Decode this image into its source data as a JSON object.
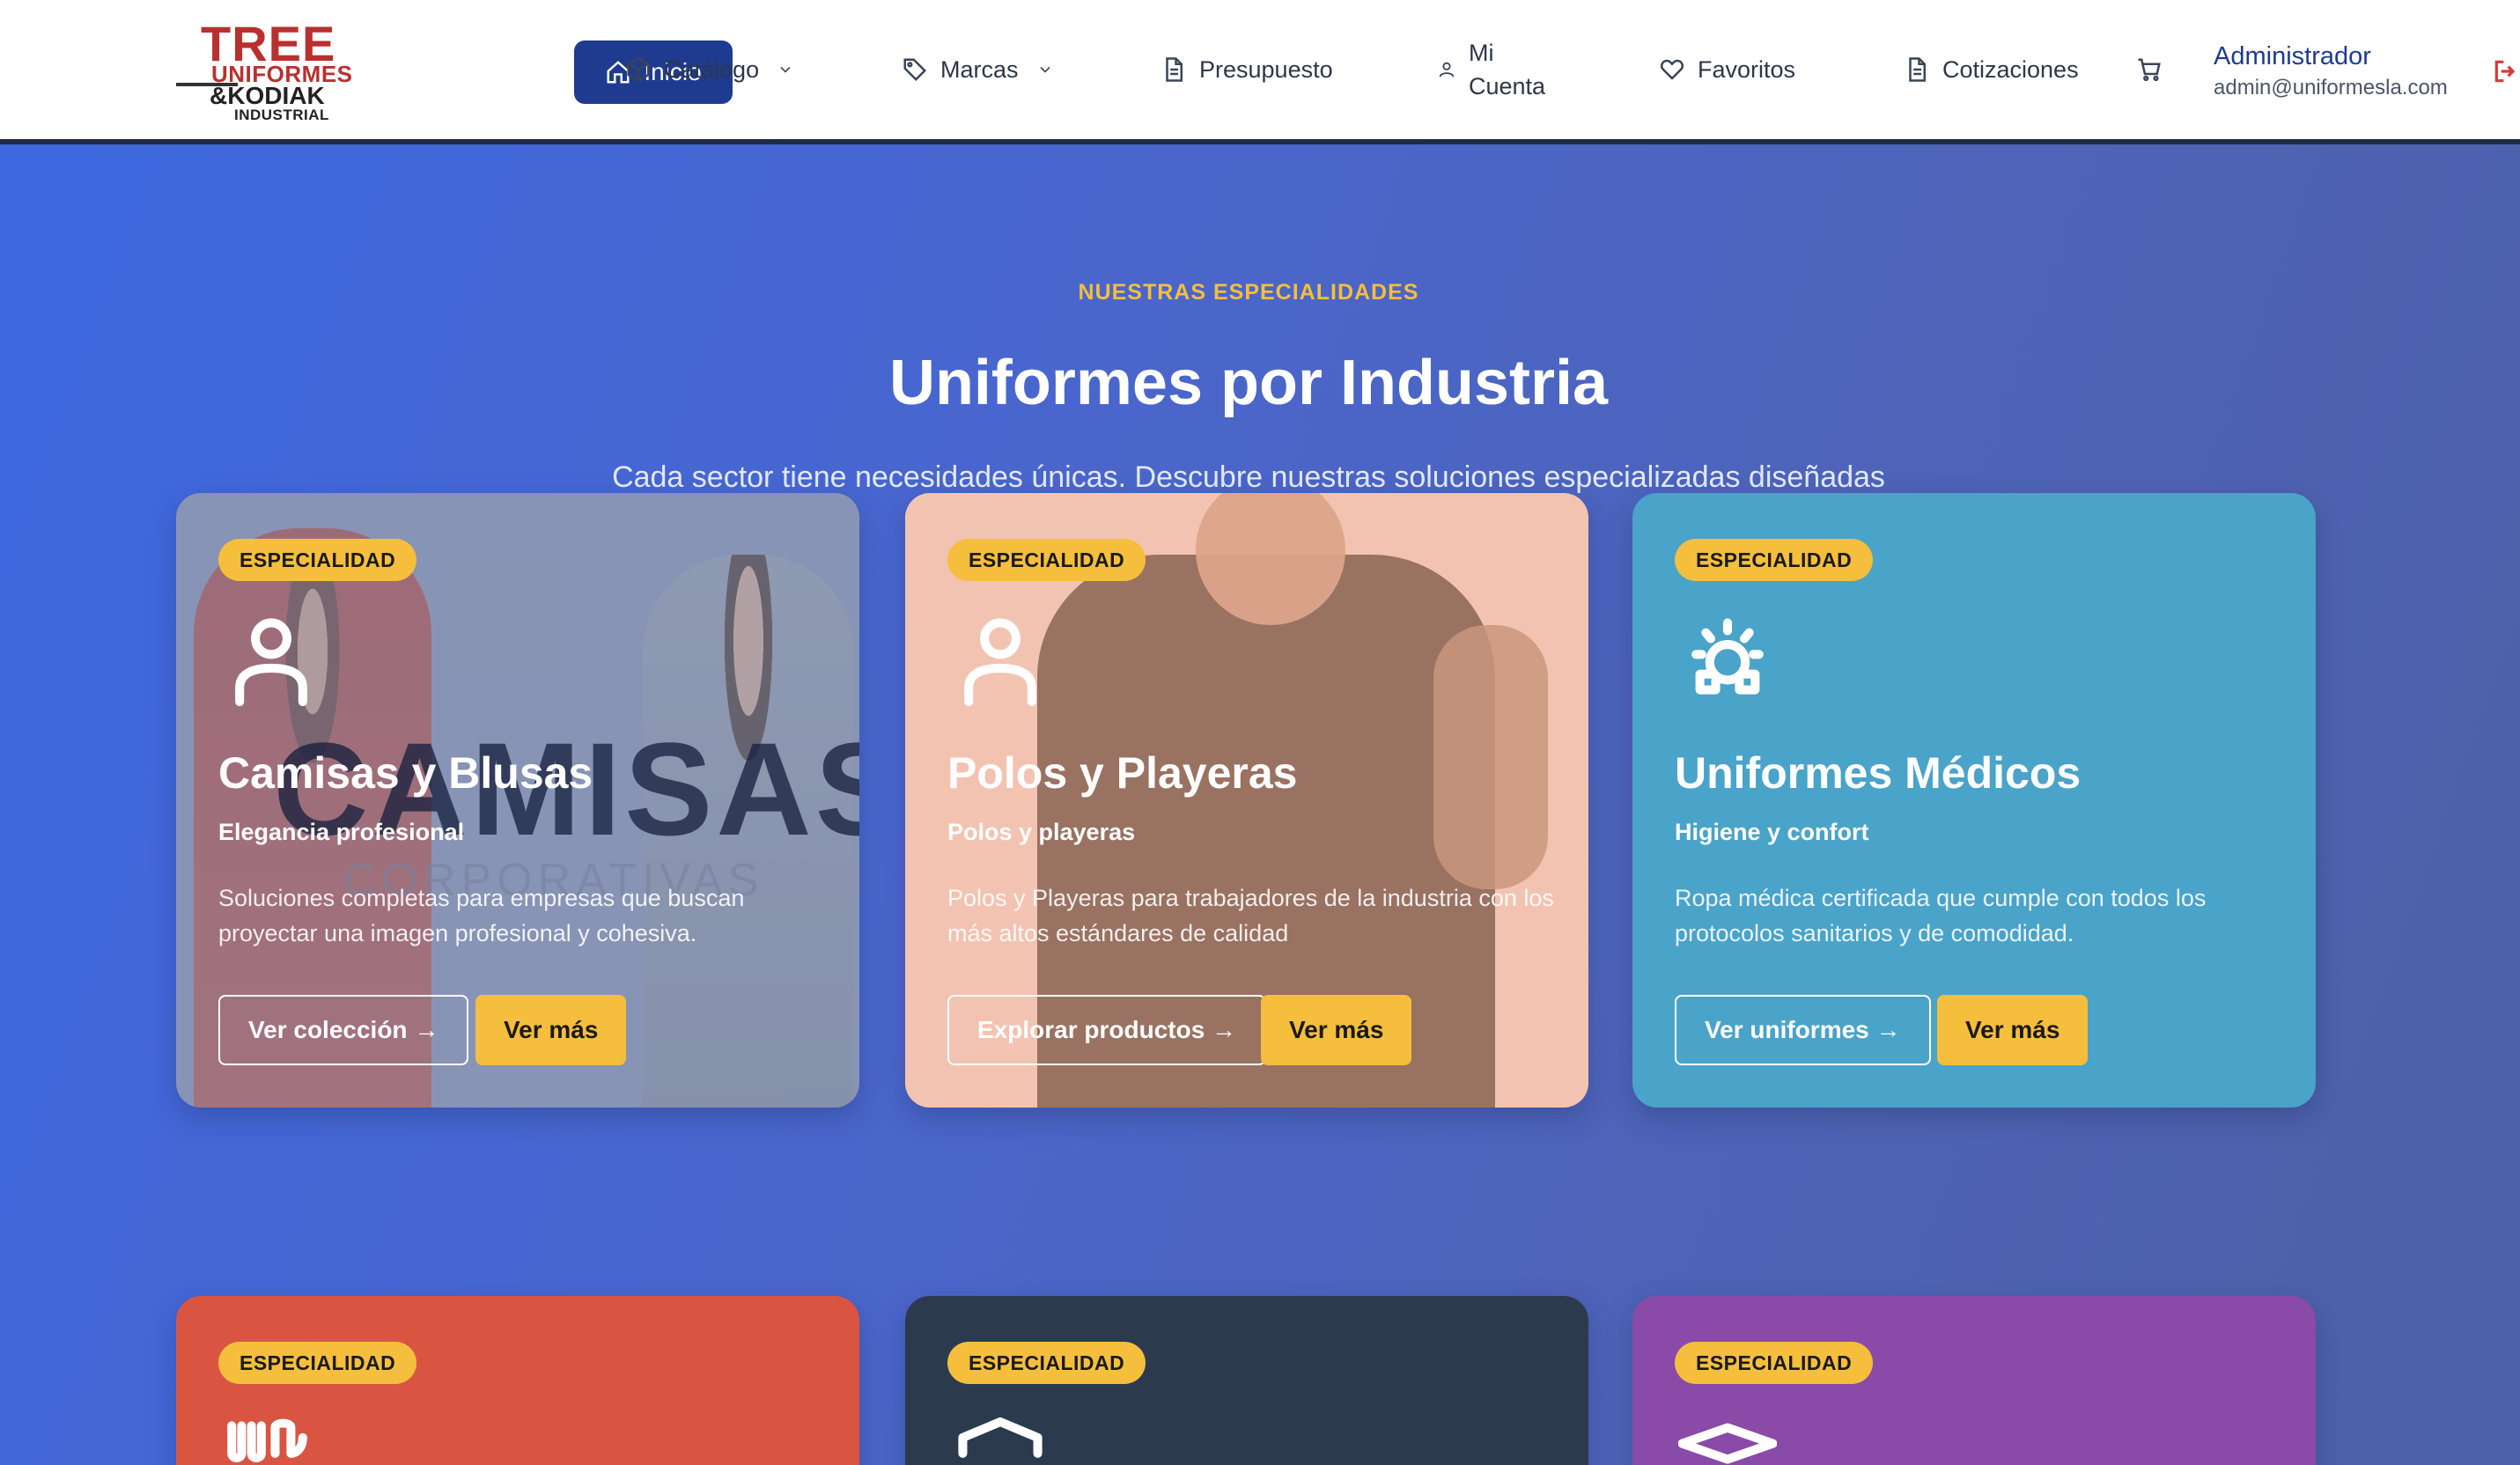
{
  "brand": {
    "logo_line1": "TREE",
    "logo_line2": "UNIFORMES",
    "logo_line3": "&KODIAK",
    "logo_line4": "INDUSTRIAL"
  },
  "nav": {
    "home": "Inicio",
    "catalog": "Catálogo",
    "brands": "Marcas",
    "budget": "Presupuesto",
    "account_line1": "Mi",
    "account_line2": "Cuenta",
    "favorites": "Favoritos",
    "quotes": "Cotizaciones"
  },
  "user": {
    "name": "Administrador",
    "email": "admin@uniformesla.com"
  },
  "hero": {
    "eyebrow": "NUESTRAS ESPECIALIDADES",
    "title": "Uniformes por Industria",
    "subtitle": "Cada sector tiene necesidades únicas. Descubre nuestras soluciones especializadas diseñadas específicamente para tu industria."
  },
  "cards": [
    {
      "badge": "ESPECIALIDAD",
      "icon": "user-icon",
      "title": "Camisas y Blusas",
      "tagline": "Elegancia profesional",
      "description": "Soluciones completas para empresas que buscan proyectar una imagen profesional y cohesiva.",
      "primary": "Ver colección →",
      "secondary": "Ver más",
      "watermark1": "CAMISAS",
      "watermark2": "CORPORATIVAS",
      "color": "#8d98b8"
    },
    {
      "badge": "ESPECIALIDAD",
      "icon": "user-icon",
      "title": "Polos y Playeras",
      "tagline": "Polos y playeras",
      "description": "Polos y Playeras para trabajadores de la industria con los más altos estándares de calidad",
      "primary": "Explorar productos →",
      "secondary": "Ver más",
      "color": "#f5c4b4"
    },
    {
      "badge": "ESPECIALIDAD",
      "icon": "medical-icon",
      "title": "Uniformes Médicos",
      "tagline": "Higiene y confort",
      "description": "Ropa médica certificada que cumple con todos los protocolos sanitarios y de comodidad.",
      "primary": "Ver uniformes →",
      "secondary": "Ver más",
      "color": "#4aa3c9"
    },
    {
      "badge": "ESPECIALIDAD",
      "icon": "chef-icon",
      "color": "#d95542"
    },
    {
      "badge": "ESPECIALIDAD",
      "icon": "shield-icon",
      "color": "#2c3a4e"
    },
    {
      "badge": "ESPECIALIDAD",
      "icon": "graduation-cap-icon",
      "color": "#8a4aa8"
    }
  ],
  "colors": {
    "accent": "#f5be3c",
    "nav_active": "#1f3b8f",
    "brand_red": "#b8312f"
  }
}
